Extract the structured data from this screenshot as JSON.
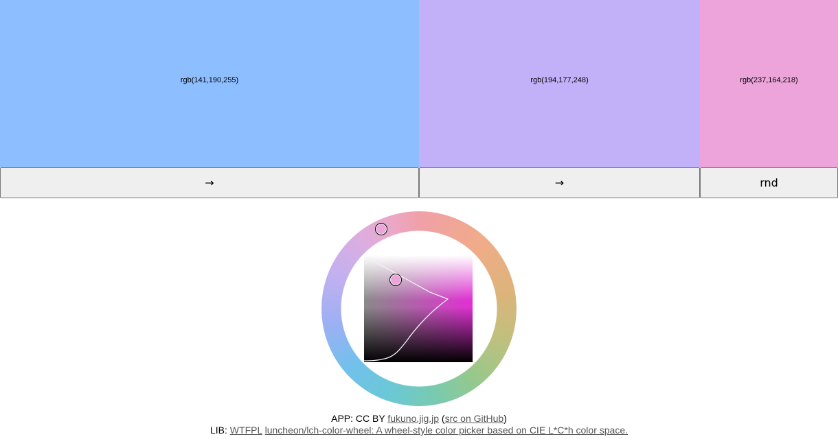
{
  "swatches": [
    {
      "label": "rgb(141,190,255)",
      "color": "#8dbeff"
    },
    {
      "label": "rgb(194,177,248)",
      "color": "#c2b1f8"
    },
    {
      "label": "rgb(237,164,218)",
      "color": "#eda4da"
    }
  ],
  "controls": {
    "next_1_label": "→",
    "next_2_label": "→",
    "random_label": "rnd"
  },
  "picker": {
    "selected_color": "#eda4da",
    "hue_handle_icon": "circle-handle",
    "chroma_handle_icon": "circle-handle"
  },
  "footer": {
    "app_prefix": "APP: CC BY ",
    "app_link": "fukuno.jig.jp",
    "app_mid": " (",
    "src_link": "src on GitHub",
    "app_suffix": ")",
    "lib_prefix": "LIB: ",
    "license_link": "WTFPL",
    "lib_space": " ",
    "lib_link": "luncheon/lch-color-wheel: A wheel-style color picker based on CIE L*C*h color space."
  }
}
